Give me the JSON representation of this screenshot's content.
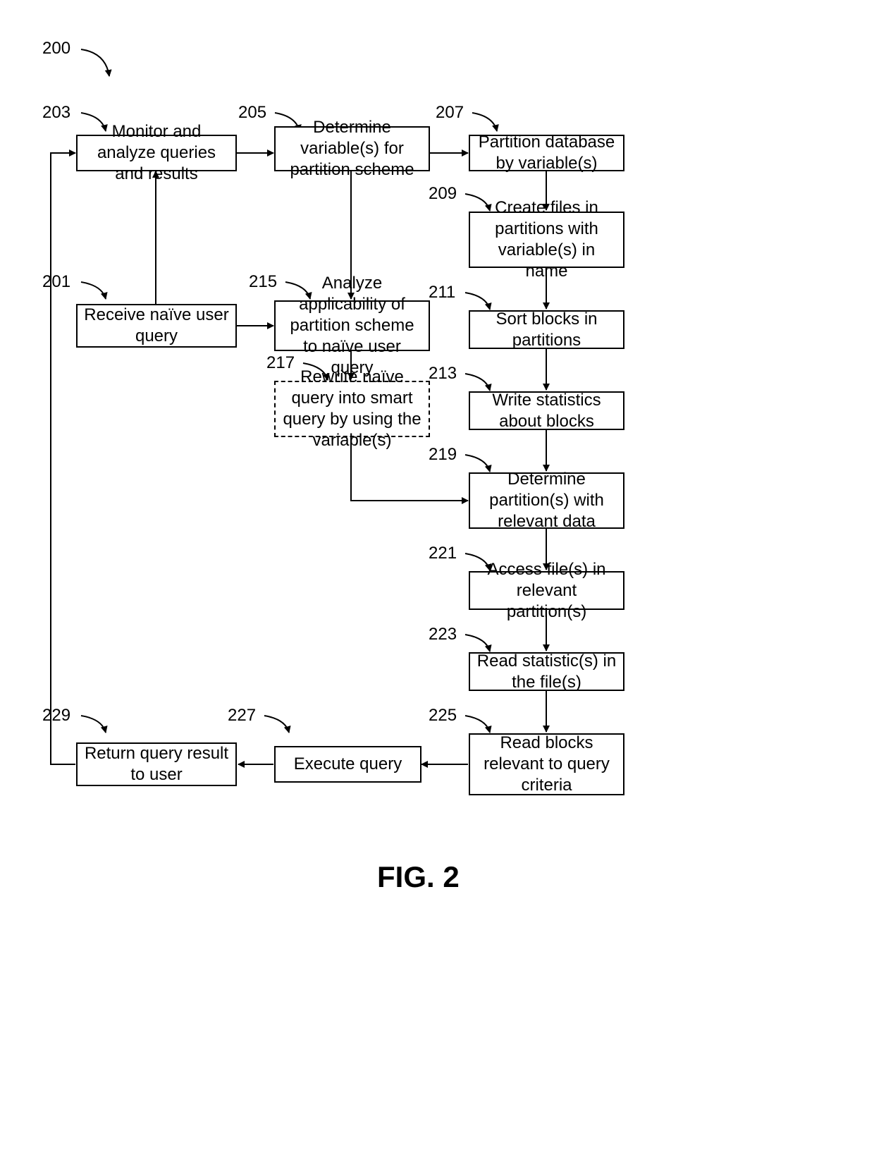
{
  "figure": {
    "number_label": "200",
    "caption": "FIG. 2"
  },
  "nodes": {
    "n201": {
      "ref": "201",
      "text": "Receive naïve user query"
    },
    "n203": {
      "ref": "203",
      "text": "Monitor and analyze queries and results"
    },
    "n205": {
      "ref": "205",
      "text": "Determine variable(s) for partition scheme"
    },
    "n207": {
      "ref": "207",
      "text": "Partition database by variable(s)"
    },
    "n209": {
      "ref": "209",
      "text": "Create files in partitions with variable(s) in name"
    },
    "n211": {
      "ref": "211",
      "text": "Sort blocks in partitions"
    },
    "n213": {
      "ref": "213",
      "text": "Write statistics about blocks"
    },
    "n215": {
      "ref": "215",
      "text": "Analyze applicability of partition scheme to naïve user query"
    },
    "n217": {
      "ref": "217",
      "text": "Rewrite naïve query into smart query by using the variable(s)"
    },
    "n219": {
      "ref": "219",
      "text": "Determine partition(s) with relevant data"
    },
    "n221": {
      "ref": "221",
      "text": "Access file(s) in relevant partition(s)"
    },
    "n223": {
      "ref": "223",
      "text": "Read statistic(s) in the file(s)"
    },
    "n225": {
      "ref": "225",
      "text": "Read blocks relevant to query criteria"
    },
    "n227": {
      "ref": "227",
      "text": "Execute query"
    },
    "n229": {
      "ref": "229",
      "text": "Return query result to user"
    }
  },
  "edges": [
    {
      "from": "n201",
      "to": "n203",
      "desc": "up"
    },
    {
      "from": "n201",
      "to": "n215",
      "desc": "right"
    },
    {
      "from": "n203",
      "to": "n205",
      "desc": "right"
    },
    {
      "from": "n205",
      "to": "n207",
      "desc": "right"
    },
    {
      "from": "n205",
      "to": "n215",
      "desc": "down"
    },
    {
      "from": "n207",
      "to": "n209",
      "desc": "down"
    },
    {
      "from": "n209",
      "to": "n211",
      "desc": "down"
    },
    {
      "from": "n211",
      "to": "n213",
      "desc": "down"
    },
    {
      "from": "n213",
      "to": "n219",
      "desc": "down"
    },
    {
      "from": "n215",
      "to": "n217",
      "desc": "down"
    },
    {
      "from": "n217",
      "to": "n219",
      "desc": "down-right-elbow"
    },
    {
      "from": "n219",
      "to": "n221",
      "desc": "down"
    },
    {
      "from": "n221",
      "to": "n223",
      "desc": "down"
    },
    {
      "from": "n223",
      "to": "n225",
      "desc": "down"
    },
    {
      "from": "n225",
      "to": "n227",
      "desc": "left"
    },
    {
      "from": "n227",
      "to": "n229",
      "desc": "left"
    },
    {
      "from": "n229",
      "to": "n203",
      "desc": "left-up-elbow"
    }
  ]
}
